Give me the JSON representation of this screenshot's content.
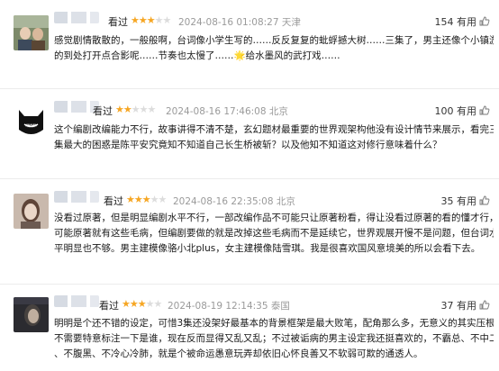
{
  "comments": [
    {
      "rating_label": "看过",
      "stars": {
        "filled": 3,
        "total": 5
      },
      "date": "2024-08-16 01:08:27",
      "location": "天津",
      "useful_count": "154 有用",
      "lines": [
        "感觉剧情散散的，一般般啊，台词像小学生写的……反反复复的蚍蜉撼大树……三集了，男主还像个小镇游客似",
        "的到处打开点合影呢……节奏也太慢了……🌟给水墨风的武打戏……"
      ]
    },
    {
      "rating_label": "看过",
      "stars": {
        "filled": 2,
        "total": 5
      },
      "date": "2024-08-16 17:46:08",
      "location": "北京",
      "useful_count": "100 有用",
      "lines": [
        "这个编剧改编能力不行，故事讲得不清不楚，玄幻题材最重要的世界观架构他没有设计情节来展示，看完三",
        "集最大的困惑是陈平安究竟知不知道自己长生桥被斩？以及他知不知道这对修行意味着什么？"
      ]
    },
    {
      "rating_label": "看过",
      "stars": {
        "filled": 3,
        "total": 5
      },
      "date": "2024-08-16 22:35:08",
      "location": "北京",
      "useful_count": "35 有用",
      "lines": [
        "没看过原著，但是明显编剧水平不行，一部改编作品不可能只让原著粉看，得让没看过原著的看的懂才行，",
        "可能原著就有这些毛病，但编剧要做的就是改掉这些毛病而不是延续它，世界观展开慢不是问题，但台词水",
        "平明显也不够。男主建模像骆小北plus，女主建模像陆雪琪。我是很喜欢国风意境美的所以会看下去。"
      ]
    },
    {
      "rating_label": "看过",
      "stars": {
        "filled": 3,
        "total": 5
      },
      "date": "2024-08-19 12:14:35",
      "location": "泰国",
      "useful_count": "37 有用",
      "lines": [
        "明明是个还不错的设定，可惜3集还没架好最基本的背景框架是最大败笔，配角那么多，无意义的其实压根",
        "不需要特意标注一下是谁，现在反而显得又乱又乱；不过被诟病的男主设定我还挺喜欢的，不霸总、不中二",
        "、不腹黑、不冷心冷肺，就是个被命运愚意玩弄却依旧心怀良善又不软弱可欺的通透人。"
      ]
    }
  ]
}
